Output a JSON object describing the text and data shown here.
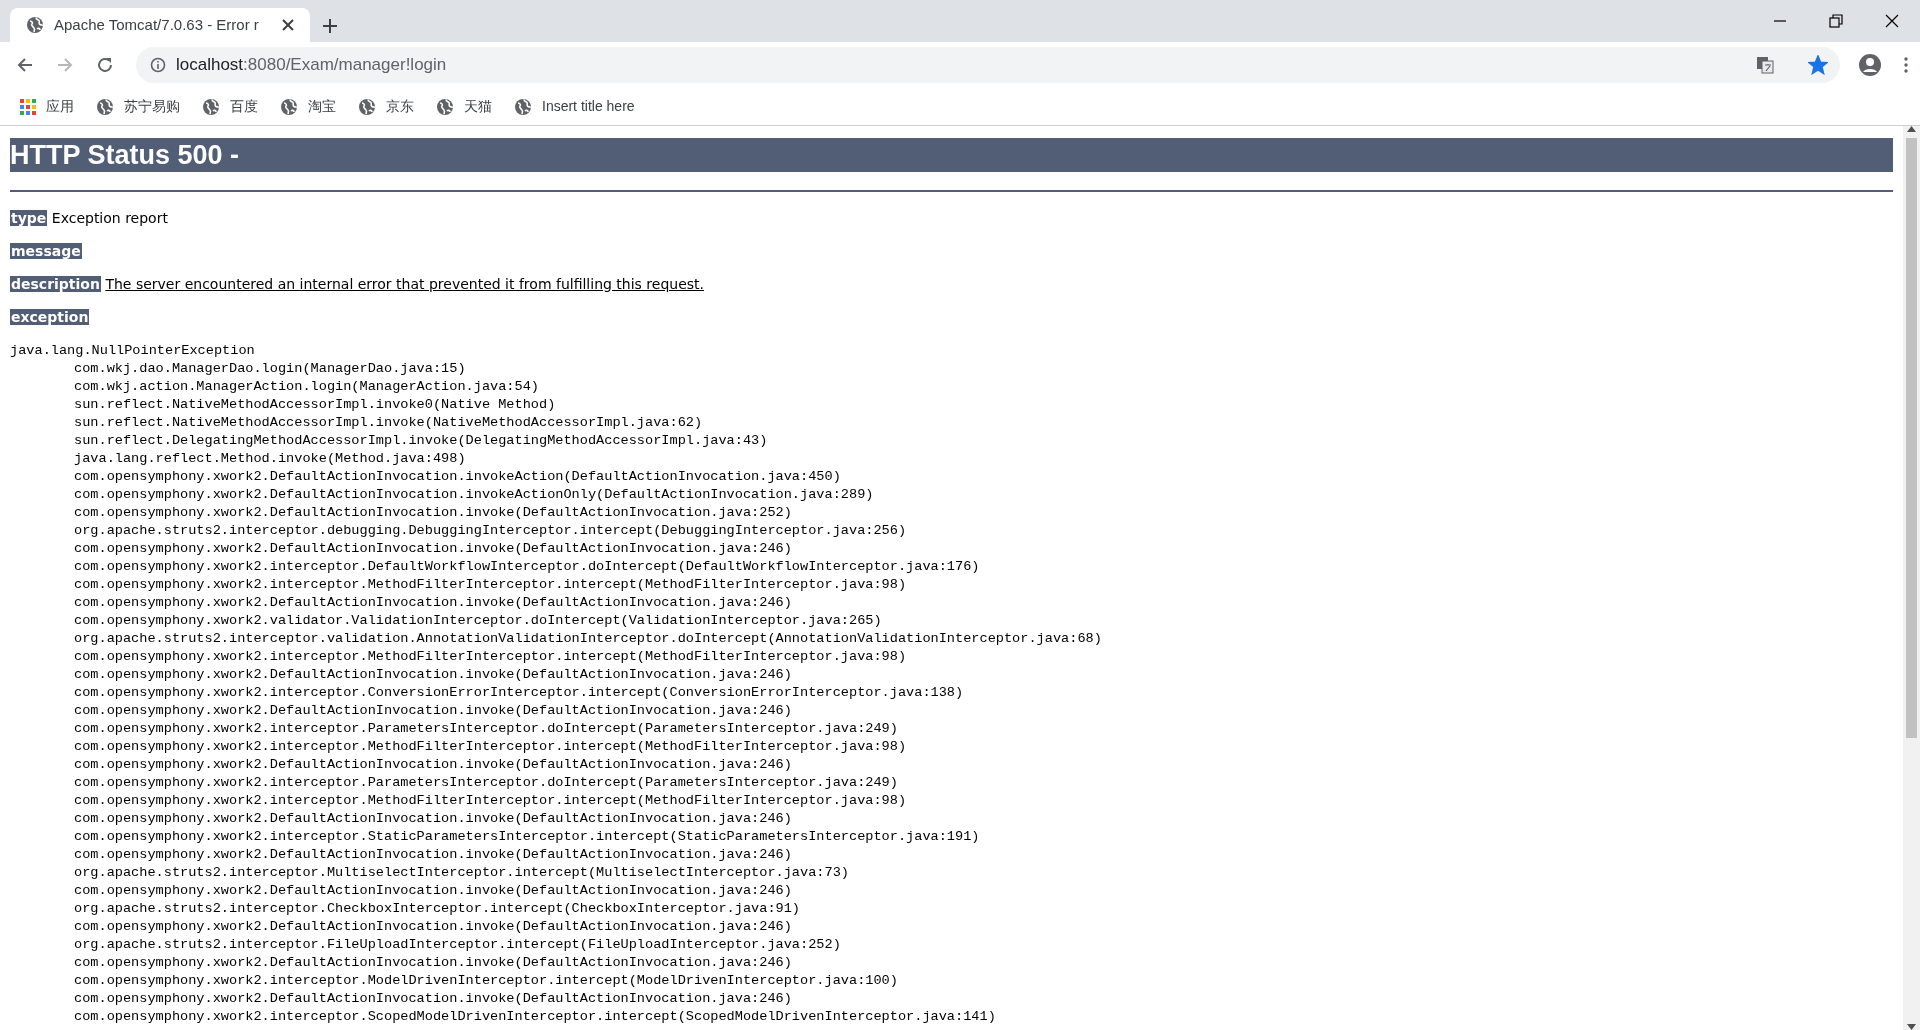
{
  "browser": {
    "tab": {
      "title": "Apache Tomcat/7.0.63 - Error r",
      "selected": true
    },
    "nav_buttons": [
      {
        "kind": "back",
        "disabled": false
      },
      {
        "kind": "forward",
        "disabled": true
      },
      {
        "kind": "reload",
        "disabled": false
      }
    ],
    "address": {
      "host": "localhost",
      "path": ":8080/Exam/manager!login"
    },
    "bookmarked": true,
    "bookmarks": [
      {
        "kind": "apps",
        "label": "应用"
      },
      {
        "kind": "site",
        "label": "苏宁易购"
      },
      {
        "kind": "site",
        "label": "百度"
      },
      {
        "kind": "site",
        "label": "淘宝"
      },
      {
        "kind": "site",
        "label": "京东"
      },
      {
        "kind": "site",
        "label": "天猫"
      },
      {
        "kind": "site",
        "label": "Insert title here"
      }
    ]
  },
  "page": {
    "title": "HTTP Status 500 -",
    "fields": [
      {
        "kind": "text",
        "label": "type",
        "value": "Exception report"
      },
      {
        "kind": "label",
        "label": "message"
      },
      {
        "kind": "link",
        "label": "description",
        "value": "The server encountered an internal error that prevented it from fulfilling this request."
      },
      {
        "kind": "label",
        "label": "exception"
      }
    ],
    "trace": {
      "head": "java.lang.NullPointerException",
      "frames": [
        "com.wkj.dao.ManagerDao.login(ManagerDao.java:15)",
        "com.wkj.action.ManagerAction.login(ManagerAction.java:54)",
        "sun.reflect.NativeMethodAccessorImpl.invoke0(Native Method)",
        "sun.reflect.NativeMethodAccessorImpl.invoke(NativeMethodAccessorImpl.java:62)",
        "sun.reflect.DelegatingMethodAccessorImpl.invoke(DelegatingMethodAccessorImpl.java:43)",
        "java.lang.reflect.Method.invoke(Method.java:498)",
        "com.opensymphony.xwork2.DefaultActionInvocation.invokeAction(DefaultActionInvocation.java:450)",
        "com.opensymphony.xwork2.DefaultActionInvocation.invokeActionOnly(DefaultActionInvocation.java:289)",
        "com.opensymphony.xwork2.DefaultActionInvocation.invoke(DefaultActionInvocation.java:252)",
        "org.apache.struts2.interceptor.debugging.DebuggingInterceptor.intercept(DebuggingInterceptor.java:256)",
        "com.opensymphony.xwork2.DefaultActionInvocation.invoke(DefaultActionInvocation.java:246)",
        "com.opensymphony.xwork2.interceptor.DefaultWorkflowInterceptor.doIntercept(DefaultWorkflowInterceptor.java:176)",
        "com.opensymphony.xwork2.interceptor.MethodFilterInterceptor.intercept(MethodFilterInterceptor.java:98)",
        "com.opensymphony.xwork2.DefaultActionInvocation.invoke(DefaultActionInvocation.java:246)",
        "com.opensymphony.xwork2.validator.ValidationInterceptor.doIntercept(ValidationInterceptor.java:265)",
        "org.apache.struts2.interceptor.validation.AnnotationValidationInterceptor.doIntercept(AnnotationValidationInterceptor.java:68)",
        "com.opensymphony.xwork2.interceptor.MethodFilterInterceptor.intercept(MethodFilterInterceptor.java:98)",
        "com.opensymphony.xwork2.DefaultActionInvocation.invoke(DefaultActionInvocation.java:246)",
        "com.opensymphony.xwork2.interceptor.ConversionErrorInterceptor.intercept(ConversionErrorInterceptor.java:138)",
        "com.opensymphony.xwork2.DefaultActionInvocation.invoke(DefaultActionInvocation.java:246)",
        "com.opensymphony.xwork2.interceptor.ParametersInterceptor.doIntercept(ParametersInterceptor.java:249)",
        "com.opensymphony.xwork2.interceptor.MethodFilterInterceptor.intercept(MethodFilterInterceptor.java:98)",
        "com.opensymphony.xwork2.DefaultActionInvocation.invoke(DefaultActionInvocation.java:246)",
        "com.opensymphony.xwork2.interceptor.ParametersInterceptor.doIntercept(ParametersInterceptor.java:249)",
        "com.opensymphony.xwork2.interceptor.MethodFilterInterceptor.intercept(MethodFilterInterceptor.java:98)",
        "com.opensymphony.xwork2.DefaultActionInvocation.invoke(DefaultActionInvocation.java:246)",
        "com.opensymphony.xwork2.interceptor.StaticParametersInterceptor.intercept(StaticParametersInterceptor.java:191)",
        "com.opensymphony.xwork2.DefaultActionInvocation.invoke(DefaultActionInvocation.java:246)",
        "org.apache.struts2.interceptor.MultiselectInterceptor.intercept(MultiselectInterceptor.java:73)",
        "com.opensymphony.xwork2.DefaultActionInvocation.invoke(DefaultActionInvocation.java:246)",
        "org.apache.struts2.interceptor.CheckboxInterceptor.intercept(CheckboxInterceptor.java:91)",
        "com.opensymphony.xwork2.DefaultActionInvocation.invoke(DefaultActionInvocation.java:246)",
        "org.apache.struts2.interceptor.FileUploadInterceptor.intercept(FileUploadInterceptor.java:252)",
        "com.opensymphony.xwork2.DefaultActionInvocation.invoke(DefaultActionInvocation.java:246)",
        "com.opensymphony.xwork2.interceptor.ModelDrivenInterceptor.intercept(ModelDrivenInterceptor.java:100)",
        "com.opensymphony.xwork2.DefaultActionInvocation.invoke(DefaultActionInvocation.java:246)",
        "com.opensymphony.xwork2.interceptor.ScopedModelDrivenInterceptor.intercept(ScopedModelDrivenInterceptor.java:141)"
      ]
    }
  }
}
